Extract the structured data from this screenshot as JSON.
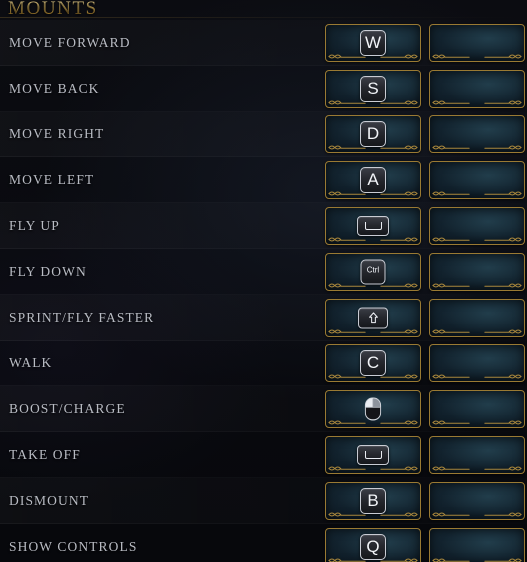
{
  "section": {
    "title": "MOUNTS"
  },
  "columns": {
    "primary_header": "",
    "secondary_header": ""
  },
  "bindings": [
    {
      "action": "MOVE FORWARD",
      "primary": {
        "type": "letter",
        "label": "W",
        "icon": "key-w-icon"
      },
      "secondary": {
        "type": "empty",
        "label": "",
        "icon": ""
      }
    },
    {
      "action": "MOVE BACK",
      "primary": {
        "type": "letter",
        "label": "S",
        "icon": "key-s-icon"
      },
      "secondary": {
        "type": "empty",
        "label": "",
        "icon": ""
      }
    },
    {
      "action": "MOVE RIGHT",
      "primary": {
        "type": "letter",
        "label": "D",
        "icon": "key-d-icon"
      },
      "secondary": {
        "type": "empty",
        "label": "",
        "icon": ""
      }
    },
    {
      "action": "MOVE LEFT",
      "primary": {
        "type": "letter",
        "label": "A",
        "icon": "key-a-icon"
      },
      "secondary": {
        "type": "empty",
        "label": "",
        "icon": ""
      }
    },
    {
      "action": "FLY UP",
      "primary": {
        "type": "space",
        "label": "Space",
        "icon": "key-spacebar-icon"
      },
      "secondary": {
        "type": "empty",
        "label": "",
        "icon": ""
      }
    },
    {
      "action": "FLY DOWN",
      "primary": {
        "type": "ctrl",
        "label": "Ctrl",
        "icon": "key-ctrl-icon"
      },
      "secondary": {
        "type": "empty",
        "label": "",
        "icon": ""
      }
    },
    {
      "action": "SPRINT/FLY FASTER",
      "primary": {
        "type": "shift",
        "label": "Shift",
        "icon": "key-shift-icon"
      },
      "secondary": {
        "type": "empty",
        "label": "",
        "icon": ""
      }
    },
    {
      "action": "WALK",
      "primary": {
        "type": "letter",
        "label": "C",
        "icon": "key-c-icon"
      },
      "secondary": {
        "type": "empty",
        "label": "",
        "icon": ""
      }
    },
    {
      "action": "BOOST/CHARGE",
      "primary": {
        "type": "mouse",
        "label": "Right Mouse Button",
        "icon": "mouse-right-button-icon"
      },
      "secondary": {
        "type": "empty",
        "label": "",
        "icon": ""
      }
    },
    {
      "action": "TAKE OFF",
      "primary": {
        "type": "space",
        "label": "Space",
        "icon": "key-spacebar-icon"
      },
      "secondary": {
        "type": "empty",
        "label": "",
        "icon": ""
      }
    },
    {
      "action": "DISMOUNT",
      "primary": {
        "type": "letter",
        "label": "B",
        "icon": "key-b-icon"
      },
      "secondary": {
        "type": "empty",
        "label": "",
        "icon": ""
      }
    },
    {
      "action": "SHOW CONTROLS",
      "primary": {
        "type": "letter",
        "label": "Q",
        "icon": "key-q-icon"
      },
      "secondary": {
        "type": "empty",
        "label": "",
        "icon": ""
      }
    }
  ],
  "colors": {
    "header_gold": "#e8c46a",
    "slot_border_gold": "#9a7a33",
    "slot_fill_teal": "#132430",
    "label_text": "#b9bcc4",
    "keycap_face": "#26282e",
    "keycap_border": "#c9ccd4",
    "page_background": "#07080c"
  }
}
